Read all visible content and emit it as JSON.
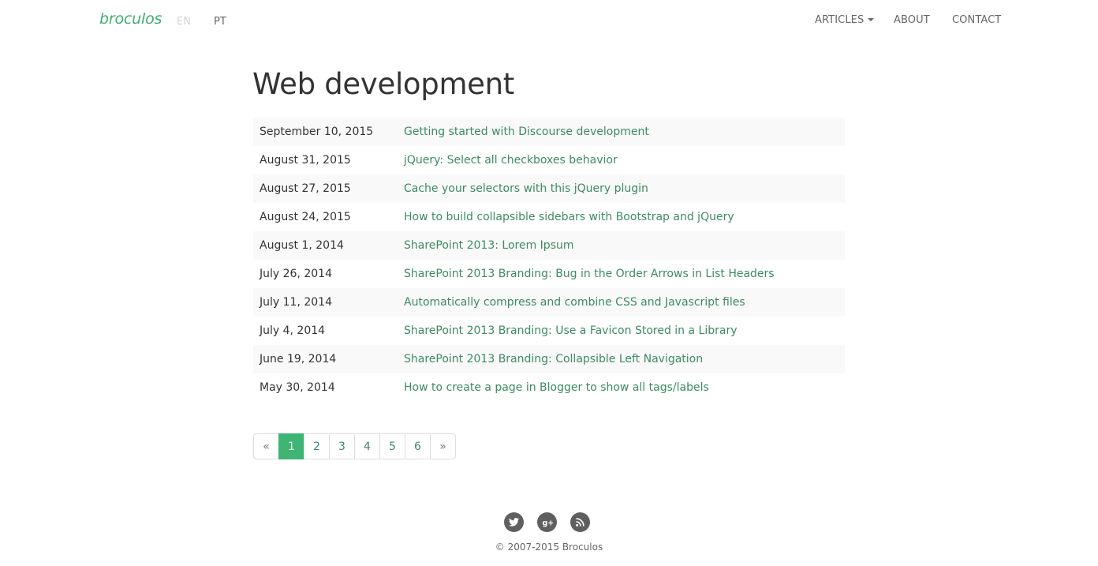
{
  "navbar": {
    "brand": "broculos",
    "languages": [
      "EN",
      "PT"
    ],
    "items": [
      {
        "label": "ARTICLES"
      },
      {
        "label": "ABOUT"
      },
      {
        "label": "CONTACT"
      }
    ]
  },
  "main": {
    "title": "Web development",
    "posts": [
      {
        "date": "September 10, 2015",
        "title": "Getting started with Discourse development"
      },
      {
        "date": "August 31, 2015",
        "title": "jQuery: Select all checkboxes behavior"
      },
      {
        "date": "August 27, 2015",
        "title": "Cache your selectors with this jQuery plugin"
      },
      {
        "date": "August 24, 2015",
        "title": "How to build collapsible sidebars with Bootstrap and jQuery"
      },
      {
        "date": "August 1, 2014",
        "title": "SharePoint 2013: Lorem Ipsum"
      },
      {
        "date": "July 26, 2014",
        "title": "SharePoint 2013 Branding: Bug in the Order Arrows in List Headers"
      },
      {
        "date": "July 11, 2014",
        "title": "Automatically compress and combine CSS and Javascript files"
      },
      {
        "date": "July 4, 2014",
        "title": "SharePoint 2013 Branding: Use a Favicon Stored in a Library"
      },
      {
        "date": "June 19, 2014",
        "title": "SharePoint 2013 Branding: Collapsible Left Navigation"
      },
      {
        "date": "May 30, 2014",
        "title": "How to create a page in Blogger to show all tags/labels"
      }
    ]
  },
  "pagination": {
    "prev": "«",
    "pages": [
      "1",
      "2",
      "3",
      "4",
      "5",
      "6"
    ],
    "next": "»",
    "current": "1"
  },
  "footer": {
    "icons": [
      "twitter-icon",
      "google-plus-icon",
      "rss-icon"
    ],
    "copyright": "© 2007-2015 Broculos"
  },
  "colors": {
    "brand": "#3eae6f",
    "link": "#3d8b61",
    "active_page": "#3eb574",
    "icon_bg": "#5f5f5f"
  }
}
